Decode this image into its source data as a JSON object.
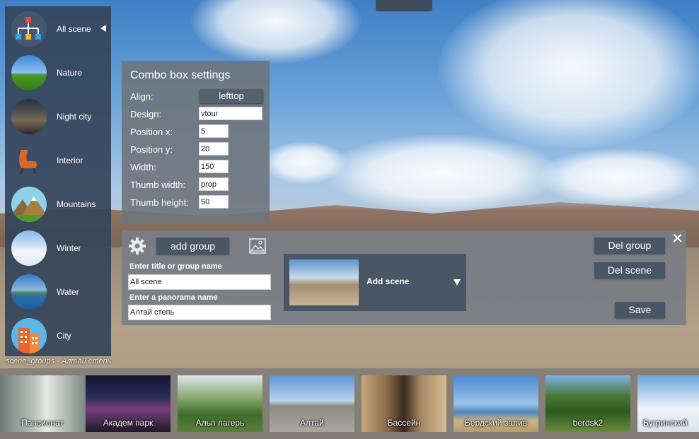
{
  "left_menu": {
    "items": [
      {
        "label": "All scene",
        "icon": "hierarchy-icon"
      },
      {
        "label": "Nature",
        "icon": "nature-icon"
      },
      {
        "label": "Night city",
        "icon": "night-city-icon"
      },
      {
        "label": "Interior",
        "icon": "chair-icon"
      },
      {
        "label": "Mountains",
        "icon": "mountains-icon"
      },
      {
        "label": "Winter",
        "icon": "winter-icon"
      },
      {
        "label": "Water",
        "icon": "water-icon"
      },
      {
        "label": "City",
        "icon": "city-icon"
      }
    ],
    "caption": "scene_groups - Алтай стеnь"
  },
  "combo_settings": {
    "title": "Combo box settings",
    "align_label": "Align:",
    "align_value": "lefttop",
    "design_label": "Design:",
    "design_value": "vtour",
    "posx_label": "Position x:",
    "posx_value": "5",
    "posy_label": "Position y:",
    "posy_value": "20",
    "width_label": "Width:",
    "width_value": "150",
    "thumbw_label": "Thumb width:",
    "thumbw_value": "prop",
    "thumbh_label": "Thumb height:",
    "thumbh_value": "50"
  },
  "group_panel": {
    "add_group": "add group",
    "title_label": "Enter title or group name",
    "title_value": "All scene",
    "pano_label": "Enter a panorama name",
    "pano_value": "Алтай степь",
    "add_scene": "Add scene",
    "del_group": "Del group",
    "del_scene": "Del scene",
    "save": "Save",
    "close": "✕"
  },
  "thumbnails": [
    {
      "label": "Пансионат"
    },
    {
      "label": "Академ парк"
    },
    {
      "label": "Альп лагерь"
    },
    {
      "label": "Алтай"
    },
    {
      "label": "Бассейн"
    },
    {
      "label": "Бердский залив"
    },
    {
      "label": "berdsk2"
    },
    {
      "label": "Бугринский"
    }
  ]
}
